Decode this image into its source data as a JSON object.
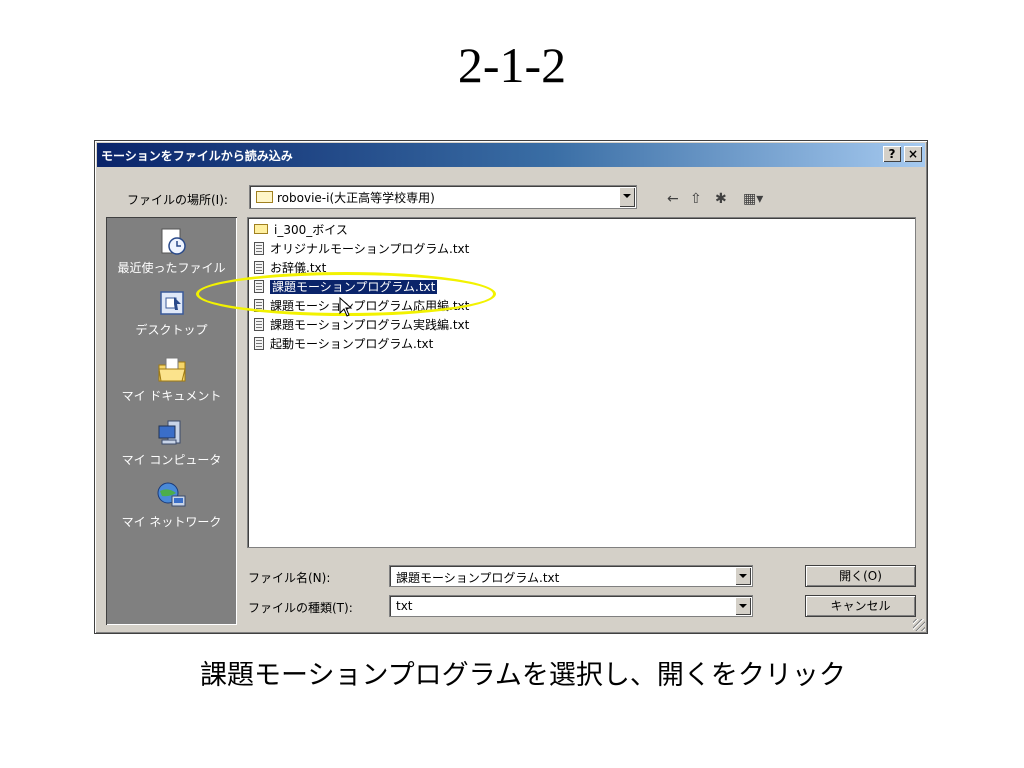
{
  "slide": {
    "title": "2-1-2",
    "caption": "課題モーションプログラムを選択し、開くをクリック"
  },
  "dialog": {
    "title": "モーションをファイルから読み込み",
    "help_label": "?",
    "close_label": "×",
    "lookin_label": "ファイルの場所(I):",
    "lookin_value": "robovie-i(大正高等学校専用)",
    "toolbar": {
      "back_icon": "←",
      "up_icon": "⇧",
      "newfolder_icon": "✱",
      "views_icon": "▦▾"
    },
    "places": [
      {
        "label": "最近使ったファイル",
        "icon": "recent-files-icon"
      },
      {
        "label": "デスクトップ",
        "icon": "desktop-icon"
      },
      {
        "label": "マイ ドキュメント",
        "icon": "my-documents-icon"
      },
      {
        "label": "マイ コンピュータ",
        "icon": "my-computer-icon"
      },
      {
        "label": "マイ ネットワーク",
        "icon": "my-network-icon"
      }
    ],
    "files": [
      {
        "name": "i_300_ボイス",
        "type": "folder"
      },
      {
        "name": "オリジナルモーションプログラム.txt",
        "type": "file"
      },
      {
        "name": "お辞儀.txt",
        "type": "file"
      },
      {
        "name": "課題モーションプログラム.txt",
        "type": "file",
        "selected": true
      },
      {
        "name": "課題モーションプログラム応用編.txt",
        "type": "file"
      },
      {
        "name": "課題モーションプログラム実践編.txt",
        "type": "file"
      },
      {
        "name": "起動モーションプログラム.txt",
        "type": "file"
      }
    ],
    "filename_label": "ファイル名(N):",
    "filename_value": "課題モーションプログラム.txt",
    "filetype_label": "ファイルの種類(T):",
    "filetype_value": "txt",
    "open_button": "開く(O)",
    "cancel_button": "キャンセル"
  },
  "colors": {
    "titlebar_start": "#0a246a",
    "titlebar_end": "#a6caf0",
    "dialog_face": "#d4d0c8",
    "places_bg": "#808080",
    "selection": "#0a246a",
    "highlight_ellipse": "#f2f200"
  }
}
